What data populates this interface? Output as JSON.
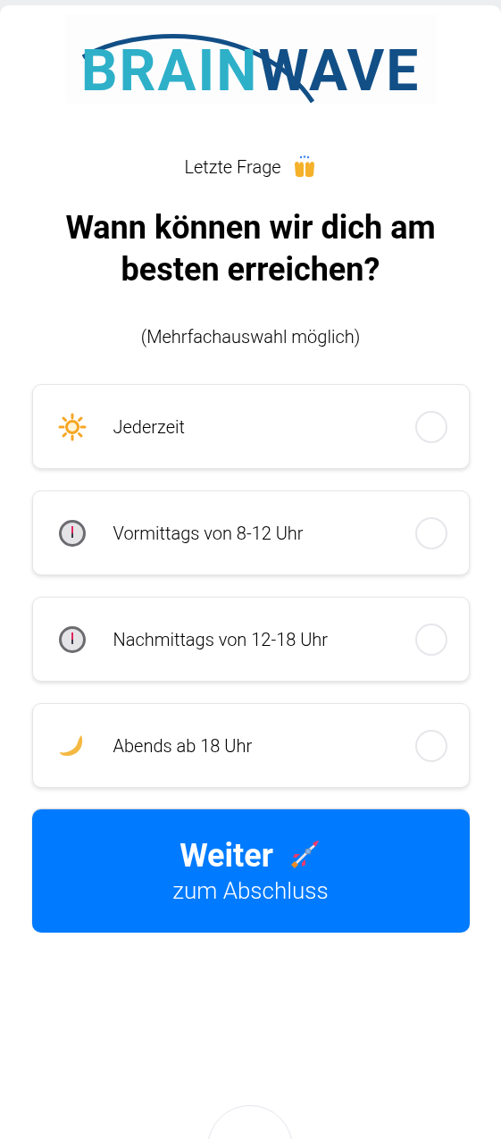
{
  "logo": {
    "part_1": "BRAIN",
    "part_2": "WAVE"
  },
  "step_label": "Letzte Frage",
  "question": "Wann können wir dich am besten erreichen?",
  "hint": "(Mehrfachauswahl möglich)",
  "options": [
    {
      "kind": "sun",
      "label": "Jederzeit",
      "checked": false
    },
    {
      "kind": "clock",
      "label": "Vormittags von 8-12 Uhr",
      "checked": false
    },
    {
      "kind": "clock",
      "label": "Nachmittags von 12-18 Uhr",
      "checked": false
    },
    {
      "kind": "moon",
      "label": "Abends ab 18 Uhr",
      "checked": false
    }
  ],
  "next_button": {
    "title": "Weiter",
    "subtitle": "zum Abschluss"
  }
}
